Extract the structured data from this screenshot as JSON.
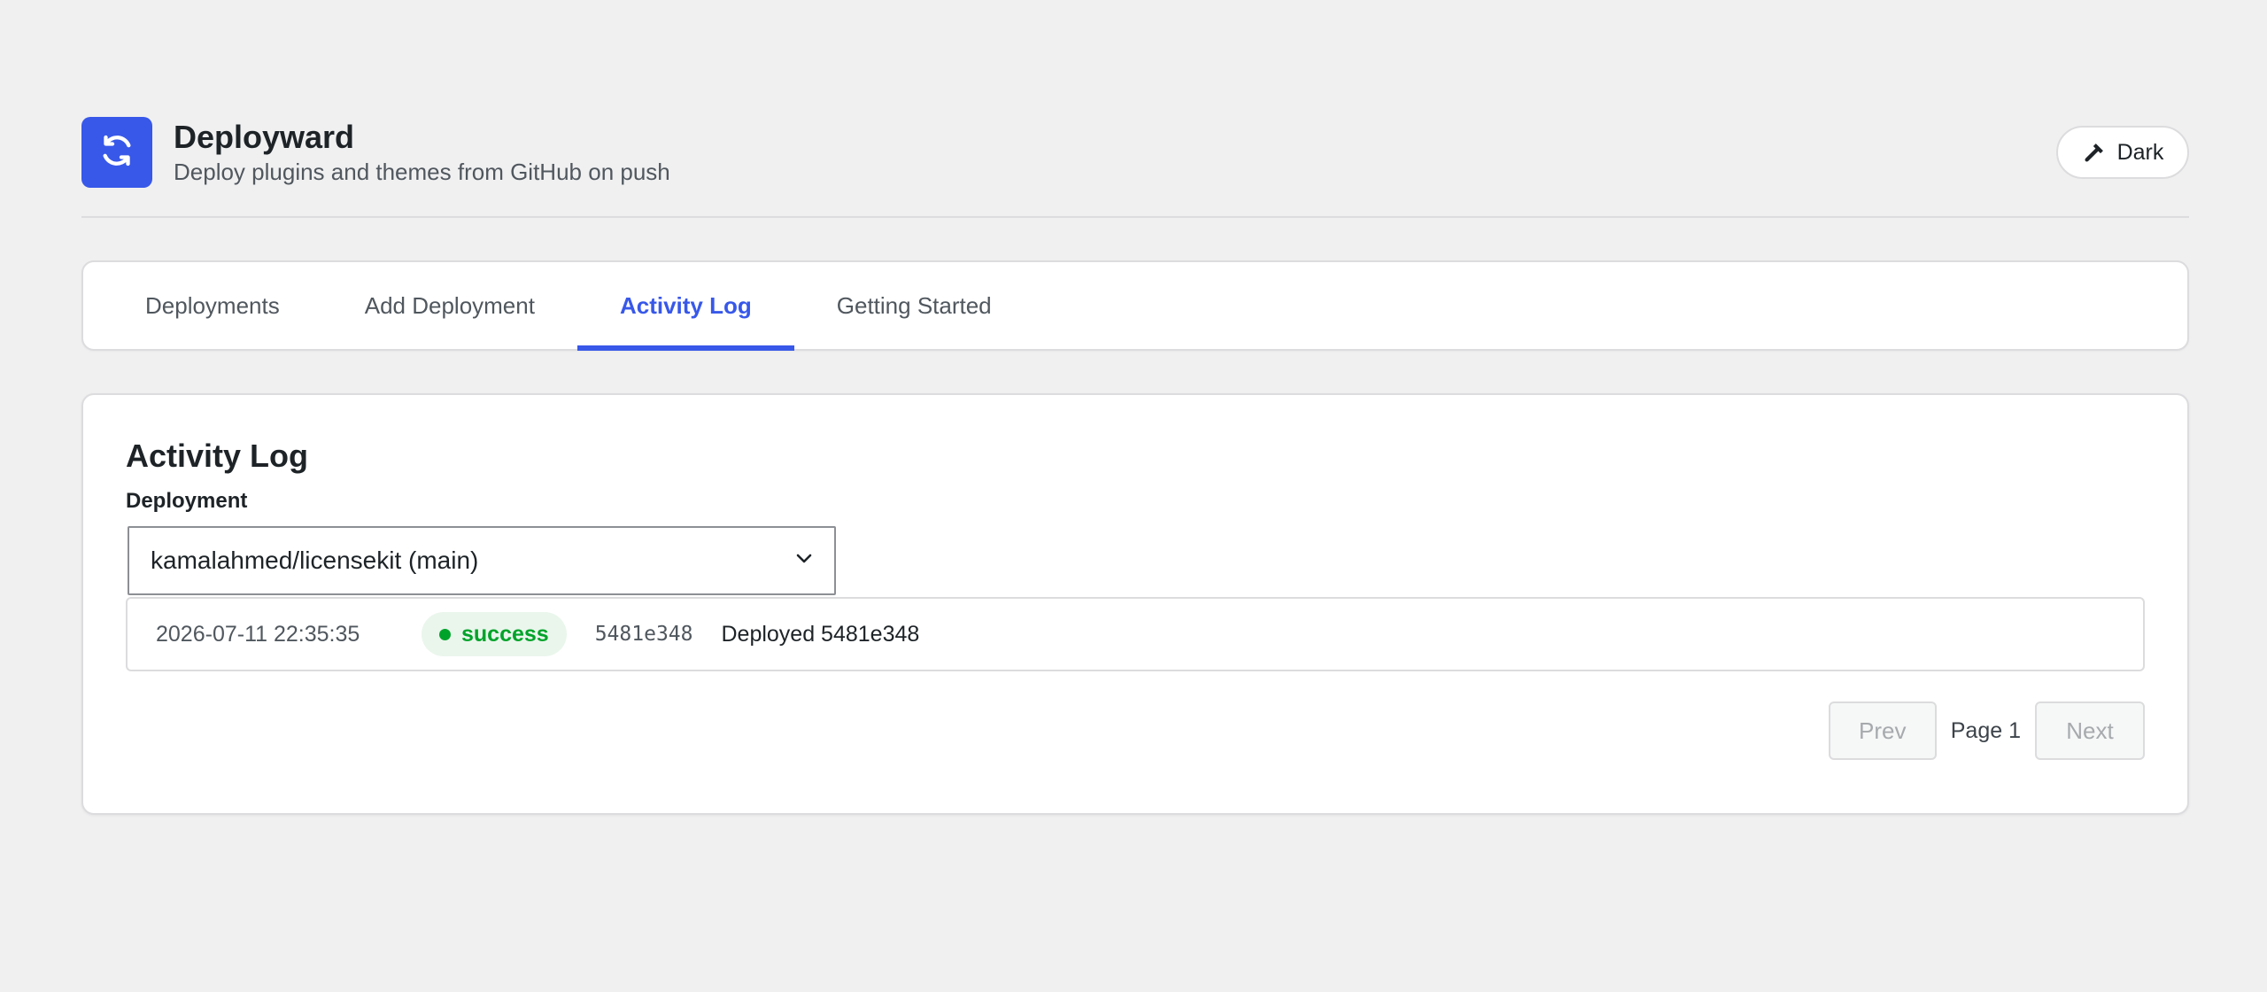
{
  "app": {
    "title": "Deployward",
    "subtitle": "Deploy plugins and themes from GitHub on push",
    "logo_icon": "sync-icon",
    "theme_toggle": {
      "label": "Dark",
      "icon": "hammer-icon"
    }
  },
  "tabs": [
    {
      "label": "Deployments",
      "active": false
    },
    {
      "label": "Add Deployment",
      "active": false
    },
    {
      "label": "Activity Log",
      "active": true
    },
    {
      "label": "Getting Started",
      "active": false
    }
  ],
  "activity_log": {
    "title": "Activity Log",
    "deployment_label": "Deployment",
    "selected_deployment": "kamalahmed/licensekit (main)",
    "entries": [
      {
        "timestamp": "2026-07-11 22:35:35",
        "status": "success",
        "commit": "5481e348",
        "message": "Deployed 5481e348"
      }
    ],
    "pagination": {
      "prev_label": "Prev",
      "page_label": "Page 1",
      "next_label": "Next"
    }
  },
  "colors": {
    "accent": "#3858e9",
    "success": "#00a32a",
    "success_bg": "#eaf6ec",
    "background": "#f0f0f1"
  }
}
